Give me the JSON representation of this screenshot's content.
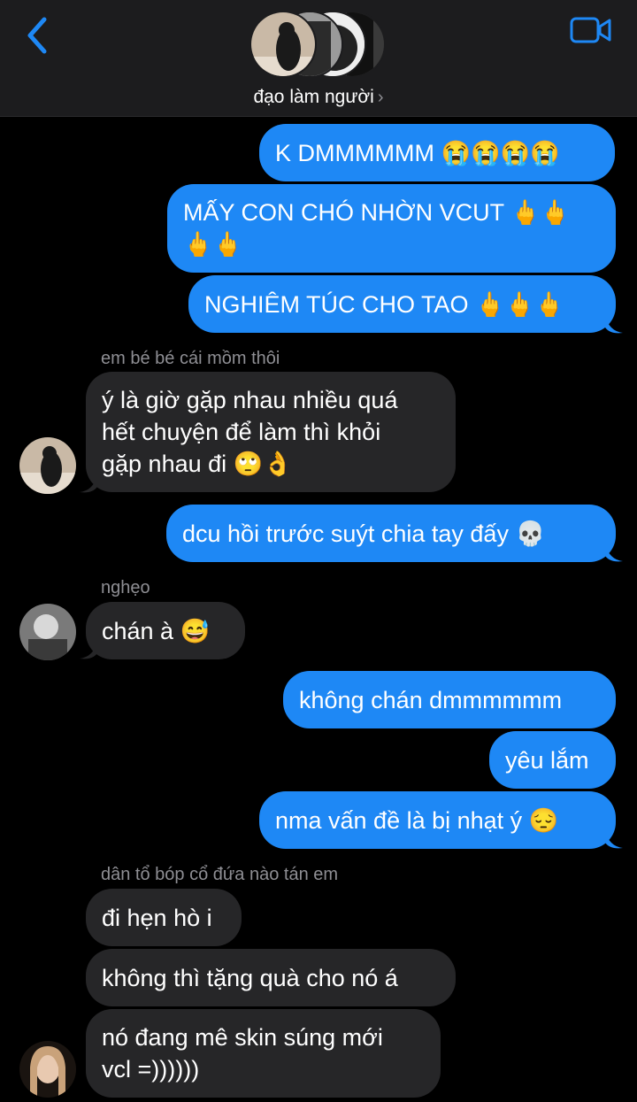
{
  "header": {
    "group_name": "đạo làm người",
    "chevron": "›",
    "back_icon": "chevron-left-icon",
    "video_icon": "video-camera-icon",
    "accent": "#1e88f5"
  },
  "colors": {
    "outgoing": "#1e88f5",
    "incoming": "#262628",
    "background": "#000000"
  },
  "messages": [
    {
      "text": "K DMMMMMM 😭😭😭😭"
    },
    {
      "line1": "MẤY CON CHÓ NHỜN VCUT 🖕🖕",
      "line2": "🖕🖕"
    },
    {
      "text": "NGHIÊM TÚC CHO TAO 🖕🖕🖕"
    },
    {
      "sender": "em bé bé cái mồm thôi",
      "line1": "ý là giờ gặp nhau nhiều quá",
      "line2": "hết chuyện để làm thì khỏi",
      "line3": "gặp nhau đi 🙄👌"
    },
    {
      "text": "dcu hồi trước suýt chia tay đấy 💀"
    },
    {
      "sender": "nghẹo",
      "text": "chán à 😅"
    },
    {
      "text": "không chán dmmmmmm"
    },
    {
      "text": "yêu lắm"
    },
    {
      "text": "nma vấn đề là bị nhạt ý 😔"
    },
    {
      "sender": "dân tổ bóp cổ đứa nào tán em",
      "text": "đi hẹn hò i"
    },
    {
      "text": "không thì tặng quà cho nó á"
    },
    {
      "line1": "nó đang mê skin súng mới",
      "line2": "vcl =))))))"
    }
  ]
}
